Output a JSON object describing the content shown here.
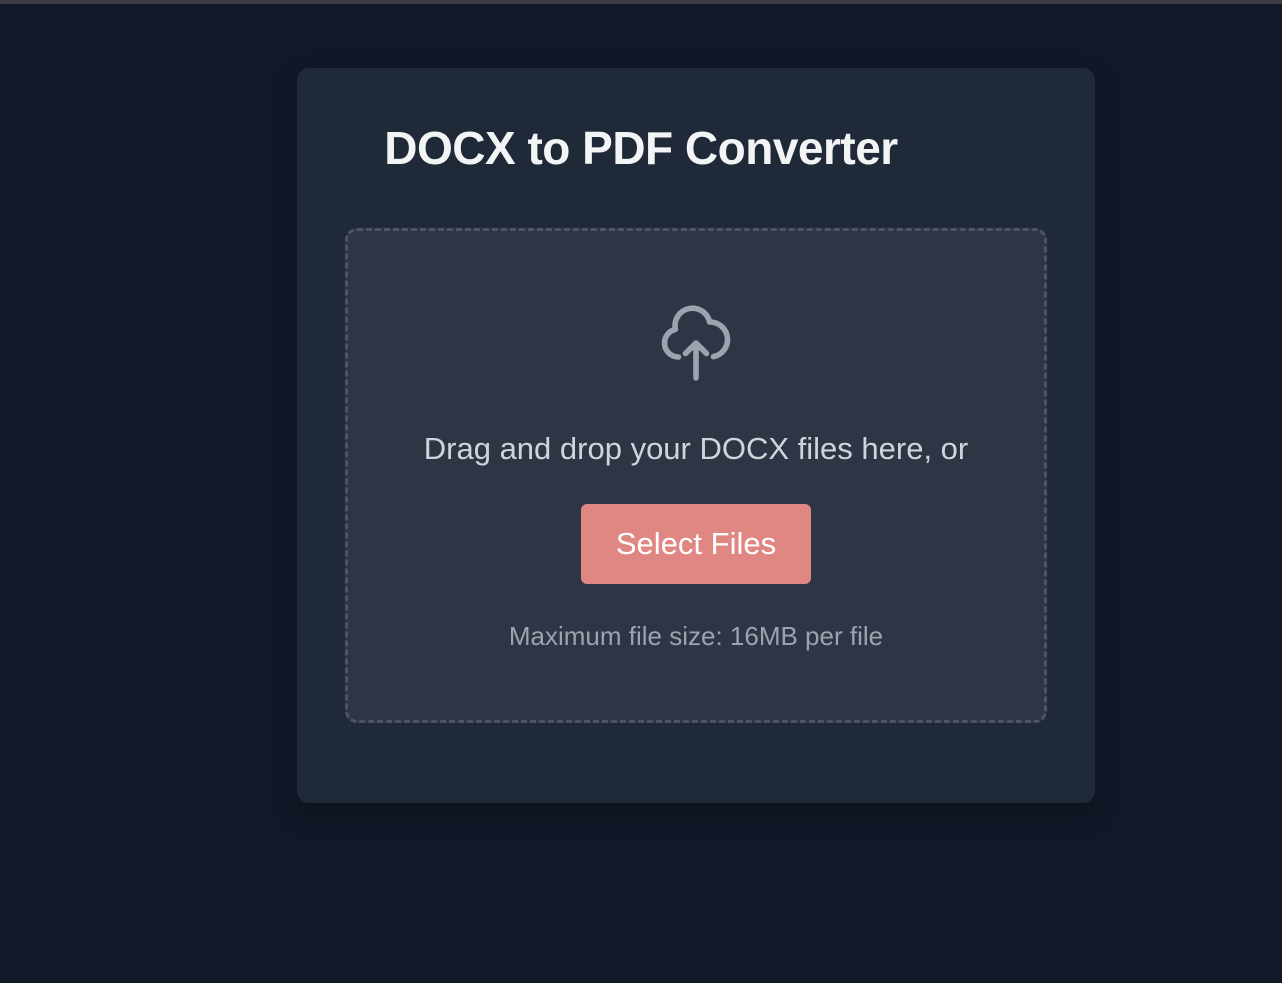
{
  "app": {
    "title": "DOCX to PDF Converter"
  },
  "dropzone": {
    "icon": "cloud-upload-icon",
    "instruction": "Drag and drop your DOCX files here, or",
    "select_button_label": "Select Files",
    "max_size_note": "Maximum file size: 16MB per file"
  },
  "colors": {
    "page_background": "#111827",
    "card_background": "#1f2937",
    "dropzone_background": "#2e3545",
    "dropzone_border": "#4b5563",
    "button_background": "#e08784",
    "icon_color": "#9ca3af"
  }
}
